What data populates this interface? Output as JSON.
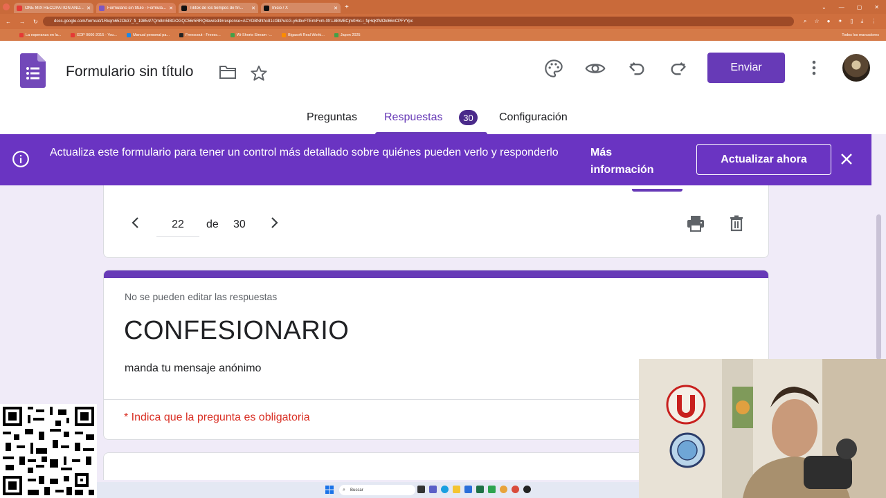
{
  "browser": {
    "tabs": [
      {
        "label": "ONE MIX RECOPATION AND...",
        "color": "#e53935"
      },
      {
        "label": "Formulario sin título - Formula...",
        "color": "#7e57c2"
      },
      {
        "label": "Tiktok de los tiempos de fin...",
        "color": "#111111"
      },
      {
        "label": "Inicio / X",
        "color": "#111111"
      }
    ],
    "new_tab": "+",
    "url": "docs.google.com/forms/d/1Rkqm652Ok37_fi_19854/7Qm8m5IBGOGQC56r5RRQ8ew/edit#response=ACYDBNhthc81ct3bPulcG-y6dbvFTEmlFvm-0fr.L8BWBCjm0Hxl.i_fqHqKfMOkl66nCPFYYpc",
    "bookmarks": [
      {
        "label": "La esperanza en la...",
        "color": "#e53935"
      },
      {
        "label": "EDP 0606-2015 - You...",
        "color": "#e53935"
      },
      {
        "label": "Manual personal pa...",
        "color": "#1e88e5"
      },
      {
        "label": "Freescout - Freesc...",
        "color": "#222222"
      },
      {
        "label": "Wi-Shorts Stream -...",
        "color": "#43a047"
      },
      {
        "label": "Bigasoft Real Worki...",
        "color": "#fb8c00"
      },
      {
        "label": "Japon 2025",
        "color": "#43a047"
      }
    ],
    "bookmarks_right": "Todos los marcadores"
  },
  "header": {
    "doc_title": "Formulario sin título",
    "send_label": "Enviar",
    "tabs": [
      {
        "label": "Preguntas"
      },
      {
        "label": "Respuestas",
        "count": "30"
      },
      {
        "label": "Configuración"
      }
    ],
    "accent": "#673ab7"
  },
  "banner": {
    "message": "Actualiza este formulario para tener un control más detallado sobre quiénes pueden verlo y responderlo",
    "more_info": "Más información",
    "update_label": "Actualizar ahora",
    "color": "#6a34c2"
  },
  "navigator": {
    "current": "22",
    "separator": "de",
    "total": "30"
  },
  "form": {
    "readonly_note": "No se pueden editar las respuestas",
    "title": "CONFESIONARIO",
    "description": "manda tu mensaje anónimo",
    "required_note": "* Indica que la pregunta es obligatoria"
  },
  "taskbar": {
    "search_placeholder": "Buscar"
  }
}
